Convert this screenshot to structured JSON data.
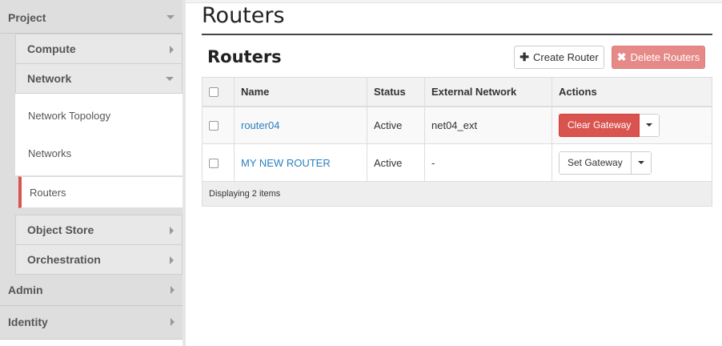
{
  "sidebar": {
    "project": "Project",
    "compute": "Compute",
    "network": "Network",
    "network_items": [
      "Network Topology",
      "Networks",
      "Routers"
    ],
    "object_store": "Object Store",
    "orchestration": "Orchestration",
    "admin": "Admin",
    "identity": "Identity"
  },
  "main": {
    "page_title": "Routers",
    "section_title": "Routers",
    "create_button": "Create Router",
    "delete_button": "Delete Routers",
    "columns": [
      "Name",
      "Status",
      "External Network",
      "Actions"
    ],
    "rows": [
      {
        "name": "router04",
        "status": "Active",
        "external_network": "net04_ext",
        "action": "Clear Gateway"
      },
      {
        "name": "MY NEW ROUTER",
        "status": "Active",
        "external_network": "-",
        "action": "Set Gateway"
      }
    ],
    "footer": "Displaying 2 items"
  },
  "colors": {
    "danger": "#d9534f",
    "link": "#2a7fbf"
  },
  "icons": {
    "create": "plus-icon",
    "delete": "x-icon"
  }
}
